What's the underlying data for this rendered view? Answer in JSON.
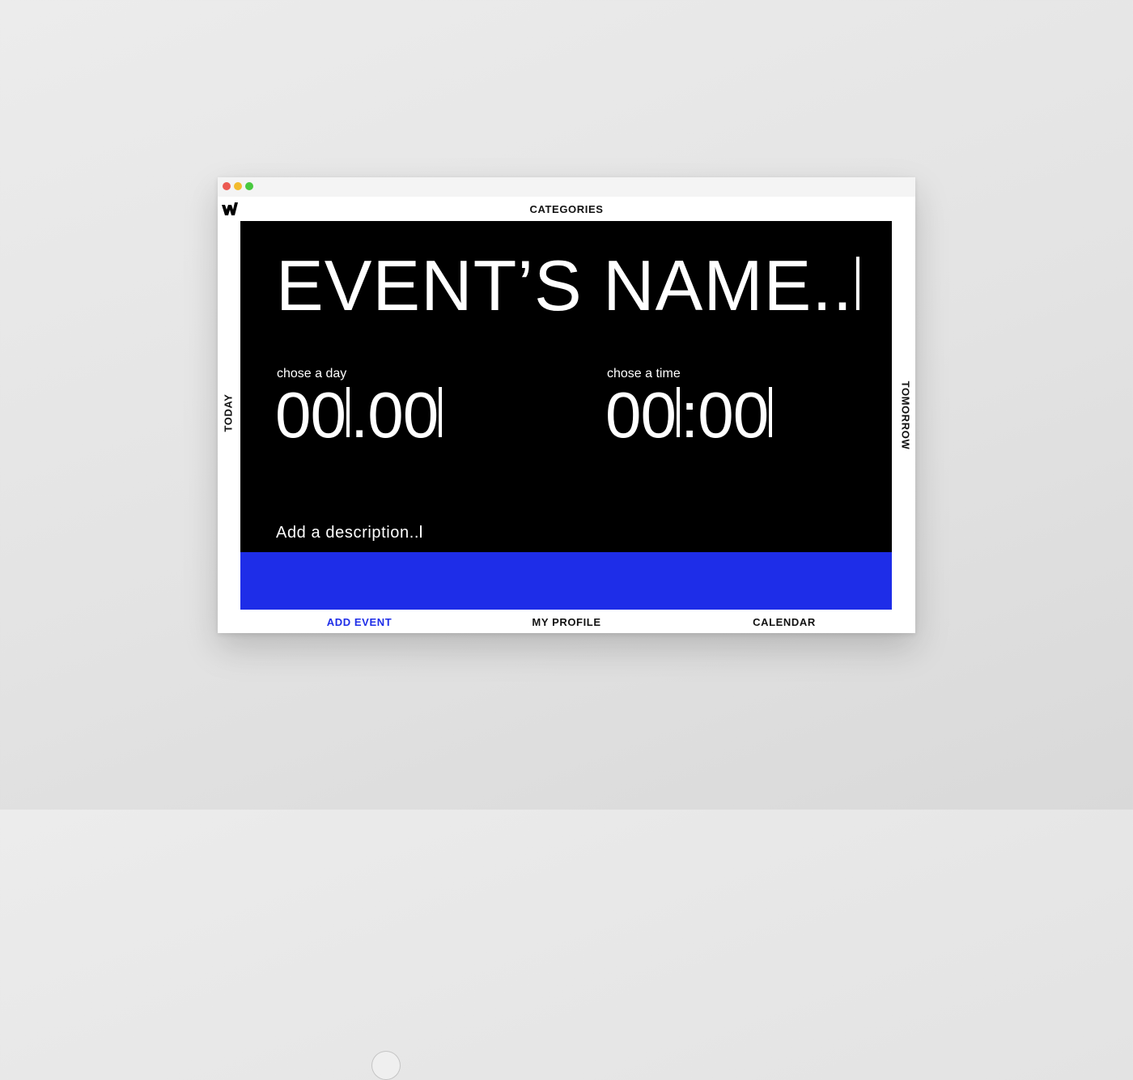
{
  "window": {
    "buttons": [
      {
        "name": "close",
        "color": "#ec5a52"
      },
      {
        "name": "minimize",
        "color": "#f2bb2d"
      },
      {
        "name": "maximize",
        "color": "#48c93f"
      }
    ],
    "logo_icon": "w-logo-icon"
  },
  "nav": {
    "top": "CATEGORIES",
    "left": "TODAY",
    "right": "TOMORROW",
    "bottom": {
      "add_event": "ADD EVENT",
      "my_profile": "MY PROFILE",
      "calendar": "CALENDAR"
    }
  },
  "event_form": {
    "name_placeholder": "EVENT’S NAME..",
    "day": {
      "label": "chose a day",
      "part1": "00",
      "separator": ".",
      "part2": "00"
    },
    "time": {
      "label": "chose a time",
      "part1": "00",
      "separator": ":",
      "part2": "00"
    },
    "description_placeholder": "Add a description.."
  },
  "colors": {
    "panel": "#000000",
    "accent_blue": "#1e2de8",
    "active_nav": "#1e2de8",
    "text_dark": "#111111",
    "text_light": "#ffffff"
  }
}
